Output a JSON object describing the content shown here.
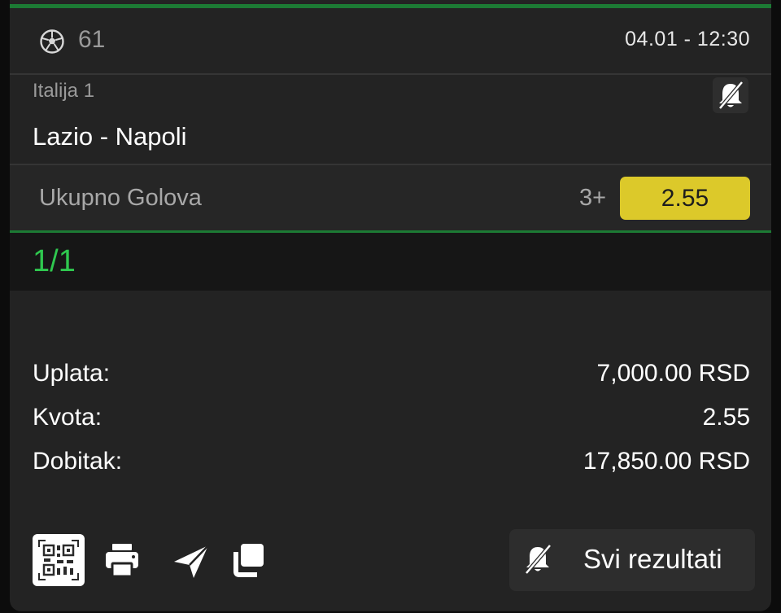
{
  "event": {
    "sport_icon": "soccer-ball-icon",
    "number": "61",
    "datetime": "04.01  -  12:30",
    "league": "Italija 1",
    "match": "Lazio - Napoli",
    "mute_icon": "bell-slash-icon"
  },
  "market": {
    "name": "Ukupno Golova",
    "selection": "3+",
    "odd": "2.55"
  },
  "ticket": {
    "count": "1/1"
  },
  "summary": [
    {
      "label": "Uplata:",
      "value": "7,000.00 RSD"
    },
    {
      "label": "Kvota:",
      "value": "2.55"
    },
    {
      "label": "Dobitak:",
      "value": "17,850.00 RSD"
    }
  ],
  "toolbar": {
    "icons": [
      "qr-code-icon",
      "printer-icon",
      "send-icon",
      "copy-icon"
    ],
    "results_label": "Svi rezultati"
  },
  "colors": {
    "accent_green": "#2fc84f",
    "odd_yellow": "#dcc92a",
    "card_bg": "#232323"
  }
}
